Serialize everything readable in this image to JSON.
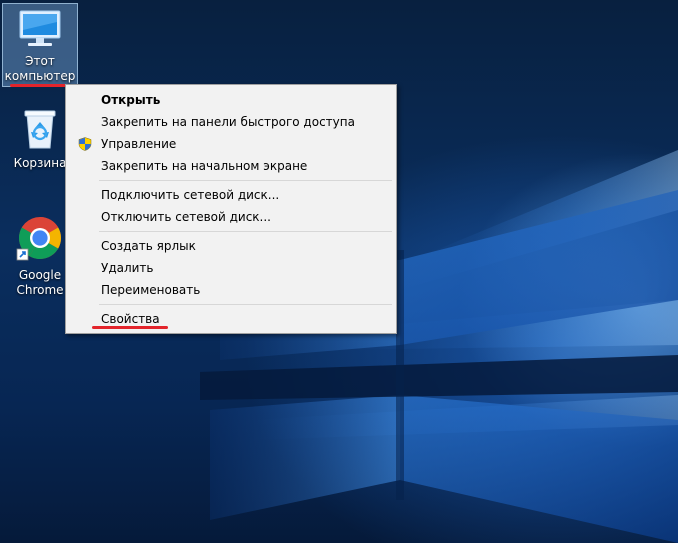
{
  "desktop": {
    "icons": [
      {
        "label": "Этот компьютер",
        "icon": "monitor-icon",
        "selected": true
      },
      {
        "label": "Корзина",
        "icon": "recycle-bin-icon",
        "selected": false
      },
      {
        "label": "Google Chrome",
        "icon": "chrome-icon",
        "shortcut": true,
        "selected": false
      }
    ],
    "accent_underline_color": "#e3242b"
  },
  "context_menu": {
    "groups": [
      [
        {
          "label": "Открыть",
          "bold": true
        },
        {
          "label": "Закрепить на панели быстрого доступа"
        },
        {
          "label": "Управление",
          "icon": "uac-shield-icon"
        },
        {
          "label": "Закрепить на начальном экране"
        }
      ],
      [
        {
          "label": "Подключить сетевой диск..."
        },
        {
          "label": "Отключить сетевой диск..."
        }
      ],
      [
        {
          "label": "Создать ярлык"
        },
        {
          "label": "Удалить"
        },
        {
          "label": "Переименовать"
        }
      ],
      [
        {
          "label": "Свойства"
        }
      ]
    ]
  },
  "colors": {
    "menu_background": "#f2f2f2",
    "menu_border": "#a0a0a0",
    "selection_highlight": "#99ccff"
  }
}
